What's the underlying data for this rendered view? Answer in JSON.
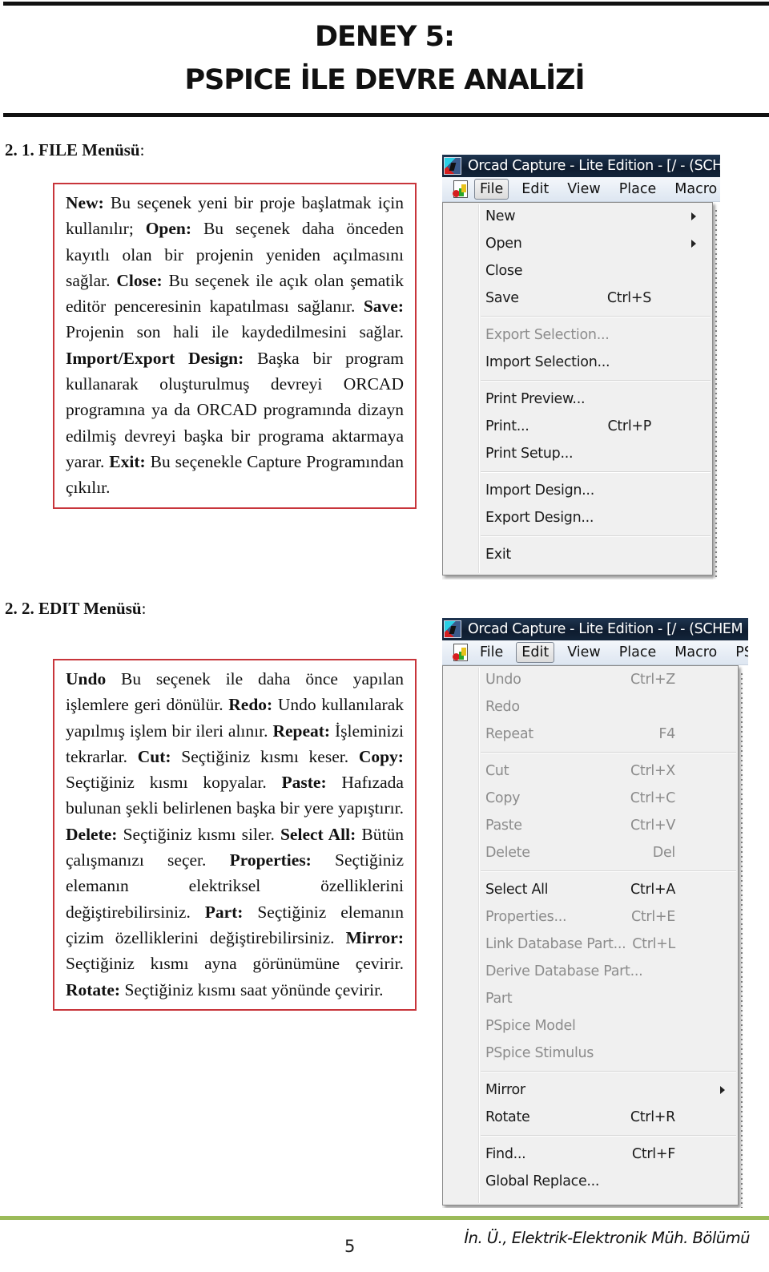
{
  "header": {
    "title_line1": "DENEY 5:",
    "title_line2": "PSPICE İLE DEVRE ANALİZİ"
  },
  "sections": [
    {
      "heading": "2. 1. FILE Menüsü",
      "description": [
        {
          "bold": "New:",
          "text": " Bu seçenek yeni bir proje başlatmak için kullanılır; "
        },
        {
          "bold": "Open:",
          "text": " Bu seçenek daha önceden kayıtlı olan bir projenin yeniden açılmasını sağlar. "
        },
        {
          "bold": "Close:",
          "text": " Bu seçenek ile açık olan şematik editör penceresinin kapatılması sağlanır. "
        },
        {
          "bold": "Save:",
          "text": " Projenin son hali ile kaydedilmesini sağlar. "
        },
        {
          "bold": "Import/Export Design:",
          "text": " Başka bir program kullanarak oluşturulmuş devreyi ORCAD programına ya da ORCAD programında dizayn edilmiş devreyi başka bir programa aktarmaya yarar. "
        },
        {
          "bold": "Exit:",
          "text": " Bu seçenekle Capture Programından çıkılır."
        }
      ],
      "screenshot": {
        "window_title": "Orcad Capture - Lite Edition - [/ - (SCH",
        "menubar": [
          "File",
          "Edit",
          "View",
          "Place",
          "Macro"
        ],
        "active_menu": "File",
        "groups": [
          [
            {
              "label": "New",
              "shortcut": "",
              "enabled": true,
              "submenu": true
            },
            {
              "label": "Open",
              "shortcut": "",
              "enabled": true,
              "submenu": true
            },
            {
              "label": "Close",
              "shortcut": "",
              "enabled": true,
              "submenu": false
            },
            {
              "label": "Save",
              "shortcut": "Ctrl+S",
              "enabled": true,
              "submenu": false
            }
          ],
          [
            {
              "label": "Export Selection...",
              "shortcut": "",
              "enabled": false,
              "submenu": false
            },
            {
              "label": "Import Selection...",
              "shortcut": "",
              "enabled": true,
              "submenu": false
            }
          ],
          [
            {
              "label": "Print Preview...",
              "shortcut": "",
              "enabled": true,
              "submenu": false
            },
            {
              "label": "Print...",
              "shortcut": "Ctrl+P",
              "enabled": true,
              "submenu": false
            },
            {
              "label": "Print Setup...",
              "shortcut": "",
              "enabled": true,
              "submenu": false
            }
          ],
          [
            {
              "label": "Import Design...",
              "shortcut": "",
              "enabled": true,
              "submenu": false
            },
            {
              "label": "Export Design...",
              "shortcut": "",
              "enabled": true,
              "submenu": false
            }
          ],
          [
            {
              "label": "Exit",
              "shortcut": "",
              "enabled": true,
              "submenu": false
            }
          ]
        ]
      }
    },
    {
      "heading": "2. 2. EDIT Menüsü",
      "description": [
        {
          "bold": "Undo",
          "text": " Bu seçenek ile daha önce yapılan işlemlere geri dönülür. "
        },
        {
          "bold": "Redo:",
          "text": " Undo kullanılarak yapılmış işlem bir ileri alınır. "
        },
        {
          "bold": "Repeat:",
          "text": " İşleminizi tekrarlar. "
        },
        {
          "bold": "Cut:",
          "text": " Seçtiğiniz kısmı keser. "
        },
        {
          "bold": "Copy:",
          "text": " Seçtiğiniz kısmı kopyalar. "
        },
        {
          "bold": "Paste:",
          "text": " Hafızada bulunan şekli belirlenen başka bir yere yapıştırır. "
        },
        {
          "bold": "Delete:",
          "text": " Seçtiğiniz kısmı siler. "
        },
        {
          "bold": "Select All:",
          "text": " Bütün çalışmanızı seçer. "
        },
        {
          "bold": "Properties:",
          "text": " Seçtiğiniz elemanın elektriksel özelliklerini değiştirebilirsiniz. "
        },
        {
          "bold": "Part:",
          "text": " Seçtiğiniz elemanın çizim özelliklerini değiştirebilirsiniz. "
        },
        {
          "bold": "Mirror:",
          "text": " Seçtiğiniz kısmı ayna görünümüne çevirir. "
        },
        {
          "bold": "Rotate:",
          "text": " Seçtiğiniz kısmı saat yönünde çevirir."
        }
      ],
      "screenshot": {
        "window_title": "Orcad Capture - Lite Edition - [/ - (SCHEM",
        "menubar": [
          "File",
          "Edit",
          "View",
          "Place",
          "Macro",
          "PSpi"
        ],
        "active_menu": "Edit",
        "groups": [
          [
            {
              "label": "Undo",
              "shortcut": "Ctrl+Z",
              "enabled": false,
              "submenu": false
            },
            {
              "label": "Redo",
              "shortcut": "",
              "enabled": false,
              "submenu": false
            },
            {
              "label": "Repeat",
              "shortcut": "F4",
              "enabled": false,
              "submenu": false
            }
          ],
          [
            {
              "label": "Cut",
              "shortcut": "Ctrl+X",
              "enabled": false,
              "submenu": false
            },
            {
              "label": "Copy",
              "shortcut": "Ctrl+C",
              "enabled": false,
              "submenu": false
            },
            {
              "label": "Paste",
              "shortcut": "Ctrl+V",
              "enabled": false,
              "submenu": false
            },
            {
              "label": "Delete",
              "shortcut": "Del",
              "enabled": false,
              "submenu": false
            }
          ],
          [
            {
              "label": "Select All",
              "shortcut": "Ctrl+A",
              "enabled": true,
              "submenu": false
            },
            {
              "label": "Properties...",
              "shortcut": "Ctrl+E",
              "enabled": false,
              "submenu": false
            },
            {
              "label": "Link Database Part...",
              "shortcut": "Ctrl+L",
              "enabled": false,
              "submenu": false
            },
            {
              "label": "Derive Database Part...",
              "shortcut": "",
              "enabled": false,
              "submenu": false
            },
            {
              "label": "Part",
              "shortcut": "",
              "enabled": false,
              "submenu": false
            },
            {
              "label": "PSpice Model",
              "shortcut": "",
              "enabled": false,
              "submenu": false
            },
            {
              "label": "PSpice Stimulus",
              "shortcut": "",
              "enabled": false,
              "submenu": false
            }
          ],
          [
            {
              "label": "Mirror",
              "shortcut": "",
              "enabled": true,
              "submenu": true
            },
            {
              "label": "Rotate",
              "shortcut": "Ctrl+R",
              "enabled": true,
              "submenu": false
            }
          ],
          [
            {
              "label": "Find...",
              "shortcut": "Ctrl+F",
              "enabled": true,
              "submenu": false
            },
            {
              "label": "Global Replace...",
              "shortcut": "",
              "enabled": true,
              "submenu": false
            }
          ]
        ]
      }
    }
  ],
  "footer": {
    "page_number": "5",
    "department": "İn. Ü., Elektrik-Elektronik Müh. Bölümü",
    "accent_color": "#9bbb59"
  },
  "colors": {
    "box_border": "#c8353b",
    "titlebar": "#0e1c2f"
  }
}
